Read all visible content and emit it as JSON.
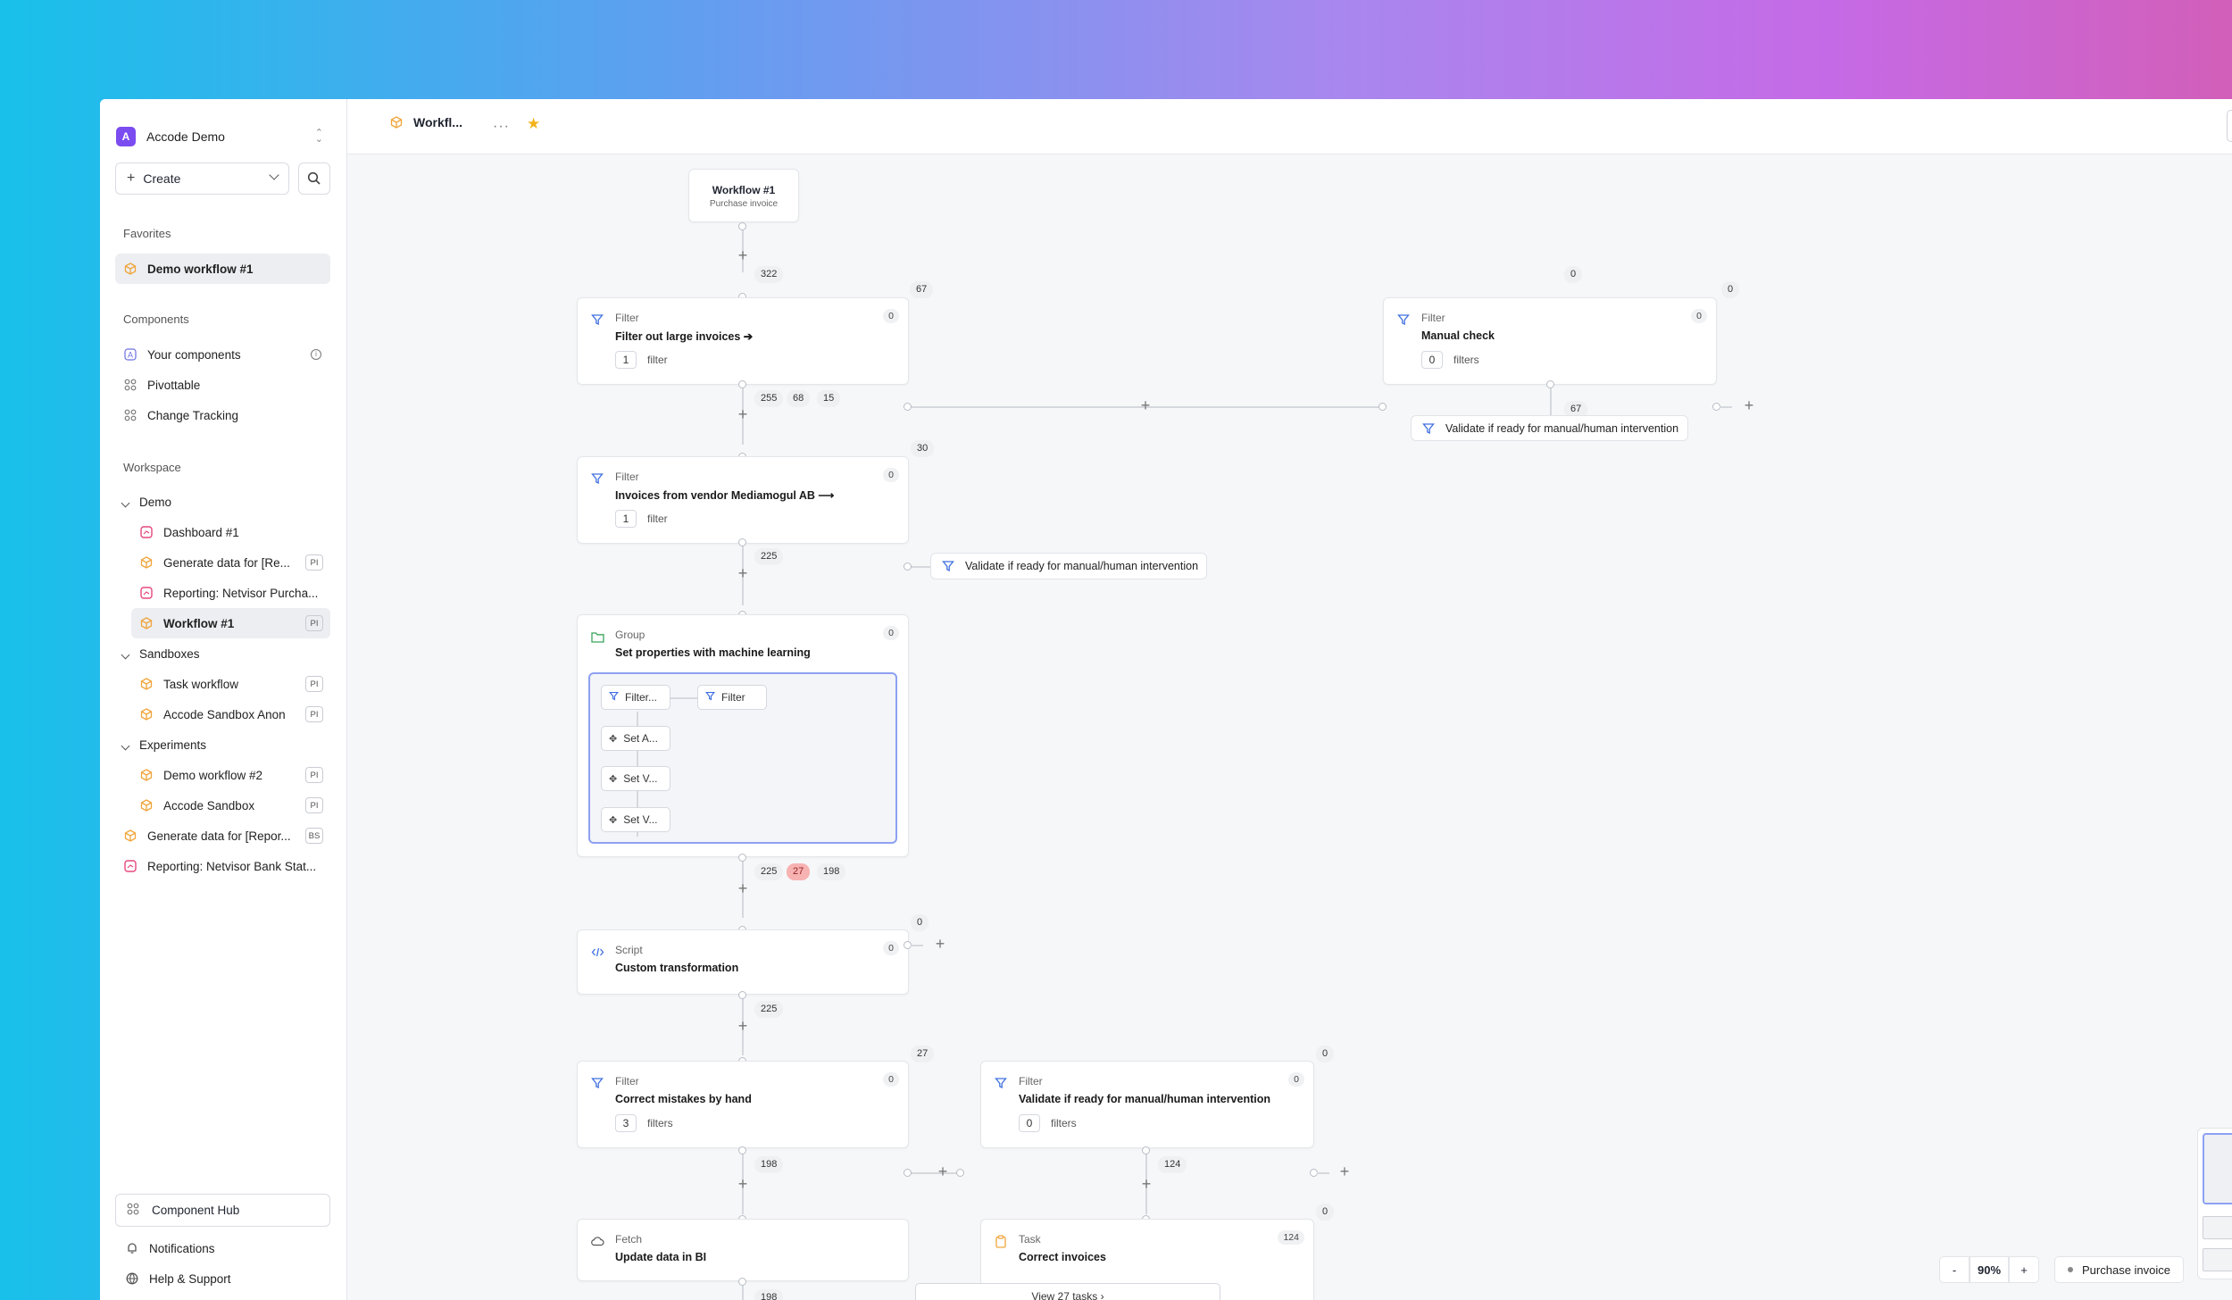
{
  "workspace": {
    "avatar_letter": "A",
    "name": "Accode Demo"
  },
  "sidebar": {
    "create_label": "Create",
    "favorites_title": "Favorites",
    "favorites": [
      {
        "label": "Demo workflow #1",
        "icon": "cube-icon"
      }
    ],
    "components_title": "Components",
    "components": [
      {
        "label": "Your components",
        "icon": "component-icon"
      },
      {
        "label": "Pivottable",
        "icon": "grid-icon"
      },
      {
        "label": "Change Tracking",
        "icon": "grid-icon"
      }
    ],
    "workspace_title": "Workspace",
    "folders": [
      {
        "label": "Demo",
        "items": [
          {
            "label": "Dashboard #1",
            "icon": "dashboard-icon",
            "badge": ""
          },
          {
            "label": "Generate data for [Re...",
            "icon": "cube-icon",
            "badge": "PI"
          },
          {
            "label": "Reporting: Netvisor Purcha...",
            "icon": "dashboard-icon",
            "badge": ""
          },
          {
            "label": "Workflow #1",
            "icon": "cube-icon",
            "badge": "PI"
          }
        ]
      },
      {
        "label": "Sandboxes",
        "items": [
          {
            "label": "Task workflow",
            "icon": "cube-icon",
            "badge": "PI"
          },
          {
            "label": "Accode Sandbox Anon",
            "icon": "cube-icon",
            "badge": "PI"
          }
        ]
      },
      {
        "label": "Experiments",
        "items": [
          {
            "label": "Demo workflow #2",
            "icon": "cube-icon",
            "badge": "PI"
          },
          {
            "label": "Accode Sandbox",
            "icon": "cube-icon",
            "badge": "PI"
          }
        ]
      }
    ],
    "root_items": [
      {
        "label": "Generate data for [Repor...",
        "icon": "cube-icon",
        "badge": "BS"
      },
      {
        "label": "Reporting: Netvisor Bank Stat...",
        "icon": "dashboard-icon",
        "badge": ""
      }
    ],
    "hub_label": "Component Hub",
    "notifications_label": "Notifications",
    "help_label": "Help & Support"
  },
  "topbar": {
    "tab_label": "Workfl...",
    "more": "···",
    "star": "★"
  },
  "canvas": {
    "start": {
      "title": "Workflow #1",
      "subtitle": "Purchase invoice"
    },
    "nodes": {
      "filter1": {
        "type": "Filter",
        "title": "Filter out large invoices ➔",
        "count": "1",
        "unit": "filter",
        "zero": "0"
      },
      "manual": {
        "type": "Filter",
        "title": "Manual check",
        "count": "0",
        "unit": "filters",
        "zero": "0"
      },
      "filter2": {
        "type": "Filter",
        "title": "Invoices from vendor Mediamogul AB ⟶",
        "count": "1",
        "unit": "filter",
        "zero": "0"
      },
      "group": {
        "type": "Group",
        "title": "Set properties with machine learning",
        "zero": "0"
      },
      "script": {
        "type": "Script",
        "title": "Custom transformation",
        "zero": "0"
      },
      "correct": {
        "type": "Filter",
        "title": "Correct mistakes by hand",
        "count": "3",
        "unit": "filters",
        "zero": "0"
      },
      "validate2": {
        "type": "Filter",
        "title": "Validate if ready for manual/human intervention",
        "count": "0",
        "unit": "filters",
        "zero": "0"
      },
      "fetch": {
        "type": "Fetch",
        "title": "Update data in BI"
      },
      "task": {
        "type": "Task",
        "title": "Correct invoices",
        "zero": "124",
        "view_tasks": "View 27 tasks"
      }
    },
    "chips": {
      "validate_a": "Validate if ready for manual/human intervention",
      "validate_b": "Validate if ready for manual/human intervention"
    },
    "group_items": {
      "filter_a": "Filter...",
      "filter_b": "Filter",
      "set_a": "Set A...",
      "set_v1": "Set V...",
      "set_v2": "Set V..."
    },
    "counts": {
      "c322": "322",
      "c67": "67",
      "c0a": "0",
      "c0b": "0",
      "c255": "255",
      "c68": "68",
      "c15": "15",
      "c67b": "67",
      "c30": "30",
      "c225": "225",
      "g225": "225",
      "g27": "27",
      "g198": "198",
      "c0s": "0",
      "c225b": "225",
      "c27": "27",
      "c0v": "0",
      "c198": "198",
      "c124": "124",
      "c0t": "0",
      "c198b": "198"
    }
  },
  "zoom": {
    "minus": "-",
    "value": "90%",
    "plus": "+"
  },
  "purchase_invoice_button": "Purchase invoice",
  "colors": {
    "accent": "#7b4cf0",
    "filter_icon": "#3f6fe0",
    "cube_icon": "#f0a43a",
    "dashboard_icon": "#e5487c",
    "group_icon": "#3aa45a",
    "highlight": "#f7b2b2"
  }
}
